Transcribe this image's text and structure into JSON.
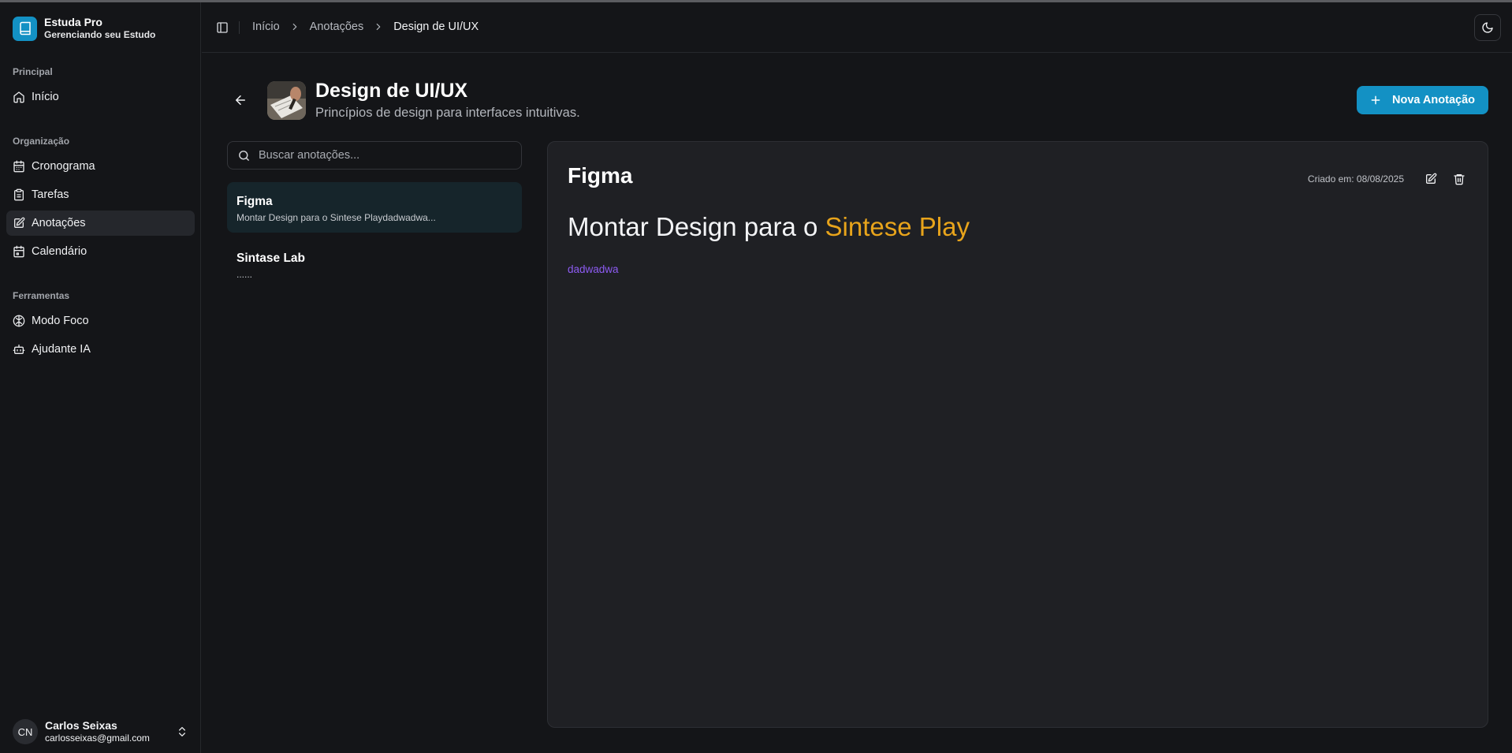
{
  "app": {
    "name": "Estuda Pro",
    "subtitle": "Gerenciando seu Estudo"
  },
  "sidebar": {
    "groups": [
      {
        "label": "Principal",
        "items": [
          {
            "label": "Início",
            "icon": "home-icon"
          }
        ]
      },
      {
        "label": "Organização",
        "items": [
          {
            "label": "Cronograma",
            "icon": "calendar-icon"
          },
          {
            "label": "Tarefas",
            "icon": "clipboard-icon"
          },
          {
            "label": "Anotações",
            "icon": "edit-note-icon",
            "active": true
          },
          {
            "label": "Calendário",
            "icon": "calendar-icon"
          }
        ]
      },
      {
        "label": "Ferramentas",
        "items": [
          {
            "label": "Modo Foco",
            "icon": "brain-icon"
          },
          {
            "label": "Ajudante IA",
            "icon": "bot-icon"
          }
        ]
      }
    ],
    "user": {
      "initials": "CN",
      "name": "Carlos Seixas",
      "email": "carlosseixas@gmail.com"
    }
  },
  "breadcrumb": {
    "items": [
      "Início",
      "Anotações",
      "Design de UI/UX"
    ]
  },
  "subject": {
    "title": "Design de UI/UX",
    "description": "Princípios de design para interfaces intuitivas."
  },
  "actions": {
    "new_note": "Nova Anotação"
  },
  "search": {
    "placeholder": "Buscar anotações..."
  },
  "notes": [
    {
      "title": "Figma",
      "preview": "Montar Design para o Sintese Playdadwadwa...",
      "active": true
    },
    {
      "title": "Sintase Lab",
      "preview": "......"
    }
  ],
  "editor": {
    "title": "Figma",
    "created": "Criado em: 08/08/2025",
    "heading_prefix": "Montar Design para o ",
    "heading_highlight": "Sintese Play",
    "paragraph": "dadwadwa"
  },
  "colors": {
    "accent": "#1391c4",
    "highlight": "#e8a41b",
    "paragraph": "#8d5bf2",
    "background": "#141518",
    "panel": "#1f2024"
  }
}
